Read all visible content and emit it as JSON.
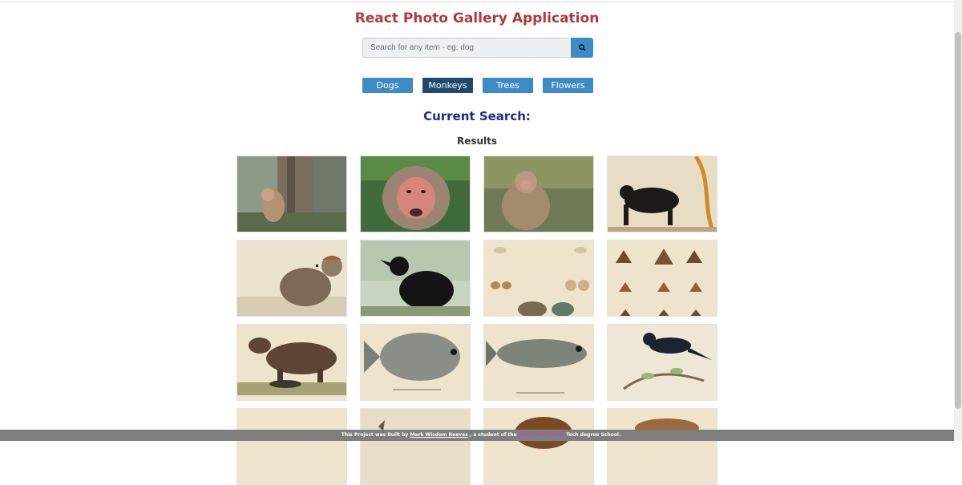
{
  "app": {
    "title": "React Photo Gallery Application"
  },
  "search": {
    "placeholder": "Search for any item - eg: dog",
    "value": "",
    "button_icon": "search-icon"
  },
  "nav": {
    "buttons": [
      "Dogs",
      "Monkeys",
      "Trees",
      "Flowers"
    ],
    "active": "Monkeys"
  },
  "current_search": {
    "label": "Current Search:"
  },
  "results": {
    "heading": "Results"
  },
  "footer": {
    "prefix": "This Project was Built by",
    "author": "Mark Wisdom Reeves",
    "middle": ", a student of the",
    "school": "Team Tree House",
    "suffix": "Tech degree School."
  },
  "colors": {
    "accent": "#3d8bc5",
    "active": "#1f4a6e",
    "title": "#b03a3a",
    "current": "#1e2a8a"
  }
}
